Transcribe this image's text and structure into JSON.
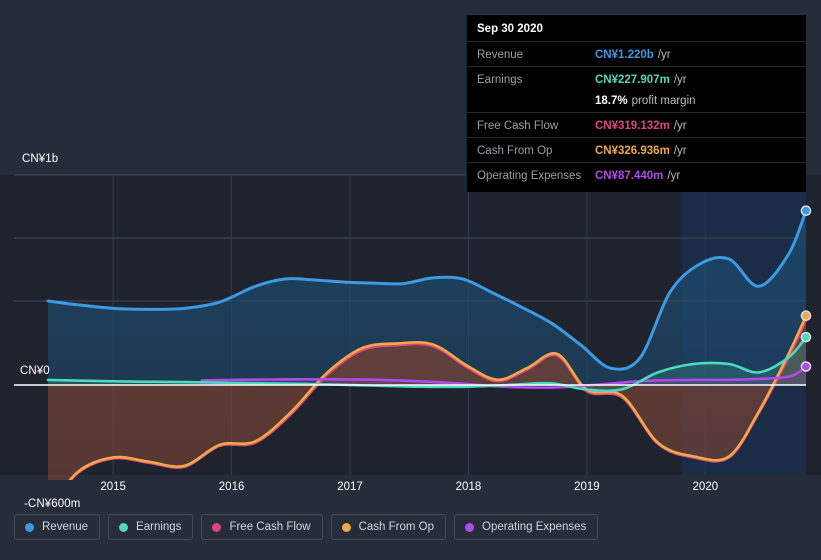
{
  "tooltip": {
    "date": "Sep 30 2020",
    "rows": [
      {
        "key": "Revenue",
        "value": "CN¥1.220b",
        "unit": "/yr",
        "color": "#3b9ae1"
      },
      {
        "key": "Earnings",
        "value": "CN¥227.907m",
        "unit": "/yr",
        "color": "#4fd8c0"
      },
      {
        "key": "",
        "value": "18.7%",
        "unit": "profit margin",
        "color": "#ffffff"
      },
      {
        "key": "Free Cash Flow",
        "value": "CN¥319.132m",
        "unit": "/yr",
        "color": "#e0467c"
      },
      {
        "key": "Cash From Op",
        "value": "CN¥326.936m",
        "unit": "/yr",
        "color": "#f0a848"
      },
      {
        "key": "Operating Expenses",
        "value": "CN¥87.440m",
        "unit": "/yr",
        "color": "#b04ae8"
      }
    ]
  },
  "legend": {
    "items": [
      {
        "label": "Revenue",
        "color": "#3b9ae1"
      },
      {
        "label": "Earnings",
        "color": "#4fd8c0"
      },
      {
        "label": "Free Cash Flow",
        "color": "#e0467c"
      },
      {
        "label": "Cash From Op",
        "color": "#f0a848"
      },
      {
        "label": "Operating Expenses",
        "color": "#b04ae8"
      }
    ]
  },
  "chart_data": {
    "type": "area",
    "title": "",
    "xlabel": "",
    "ylabel": "",
    "currency": "CN¥",
    "grid": true,
    "legend_position": "bottom",
    "y_axis": {
      "ticks": [
        {
          "label": "CN¥1b",
          "value": 1000
        },
        {
          "label": "CN¥0",
          "value": 0
        },
        {
          "label": "-CN¥600m",
          "value": -600
        }
      ],
      "ylim": [
        -600,
        1000
      ],
      "unit": "millions CN¥"
    },
    "x_axis": {
      "tick_labels": [
        "2015",
        "2016",
        "2017",
        "2018",
        "2019",
        "2020"
      ],
      "tick_values": [
        2015,
        2016,
        2017,
        2018,
        2019,
        2020
      ],
      "xlim": [
        2014.45,
        2020.85
      ]
    },
    "highlight_band": {
      "from": 2019.8,
      "to": 2020.85
    },
    "series": [
      {
        "name": "Revenue",
        "color": "#3b9ae1",
        "fill": "#1d4a6e",
        "x": [
          2014.45,
          2014.7,
          2015.0,
          2015.3,
          2015.6,
          2015.9,
          2016.2,
          2016.45,
          2016.7,
          2016.95,
          2017.2,
          2017.45,
          2017.7,
          2017.95,
          2018.2,
          2018.45,
          2018.7,
          2018.95,
          2019.2,
          2019.45,
          2019.7,
          2019.95,
          2020.2,
          2020.45,
          2020.7,
          2020.85
        ],
        "values": [
          400,
          382,
          365,
          360,
          365,
          395,
          470,
          505,
          500,
          490,
          485,
          483,
          510,
          505,
          440,
          370,
          295,
          190,
          80,
          130,
          440,
          575,
          600,
          470,
          620,
          830
        ]
      },
      {
        "name": "Earnings",
        "color": "#4fd8c0",
        "fill": "#2f7a77",
        "x": [
          2014.45,
          2014.8,
          2015.2,
          2015.6,
          2016.0,
          2016.4,
          2016.8,
          2017.2,
          2017.6,
          2018.0,
          2018.4,
          2018.7,
          2019.0,
          2019.3,
          2019.6,
          2019.9,
          2020.2,
          2020.45,
          2020.7,
          2020.85
        ],
        "values": [
          24,
          20,
          16,
          14,
          10,
          7,
          3,
          -3,
          -8,
          -8,
          2,
          8,
          -22,
          -20,
          60,
          100,
          100,
          60,
          130,
          228
        ]
      },
      {
        "name": "Free Cash Flow",
        "color": "#e0467c",
        "fill": "#6e2b3c",
        "x": [
          2014.45,
          2014.7,
          2015.0,
          2015.3,
          2015.6,
          2015.9,
          2016.2,
          2016.5,
          2016.8,
          2017.1,
          2017.4,
          2017.7,
          2018.0,
          2018.25,
          2018.5,
          2018.75,
          2019.0,
          2019.3,
          2019.6,
          2019.9,
          2020.2,
          2020.45,
          2020.7,
          2020.85
        ],
        "values": [
          -600,
          -420,
          -350,
          -370,
          -390,
          -290,
          -275,
          -140,
          45,
          165,
          190,
          185,
          80,
          18,
          75,
          140,
          -30,
          -60,
          -280,
          -345,
          -345,
          -135,
          130,
          310
        ]
      },
      {
        "name": "Cash From Op",
        "color": "#f0a848",
        "fill": "#6e4a33",
        "x": [
          2014.45,
          2014.7,
          2015.0,
          2015.3,
          2015.6,
          2015.9,
          2016.2,
          2016.5,
          2016.8,
          2017.1,
          2017.4,
          2017.7,
          2018.0,
          2018.25,
          2018.5,
          2018.75,
          2019.0,
          2019.3,
          2019.6,
          2019.9,
          2020.2,
          2020.45,
          2020.7,
          2020.85
        ],
        "values": [
          -600,
          -415,
          -345,
          -365,
          -385,
          -285,
          -268,
          -130,
          55,
          175,
          198,
          193,
          88,
          25,
          82,
          148,
          -22,
          -52,
          -275,
          -340,
          -340,
          -128,
          145,
          330
        ]
      },
      {
        "name": "Operating Expenses",
        "color": "#b04ae8",
        "fill": "#6b4c8c",
        "x": [
          2014.45,
          2015.55,
          2015.75,
          2016.1,
          2016.6,
          2017.1,
          2017.5,
          2017.9,
          2018.3,
          2018.7,
          2019.1,
          2019.5,
          2019.9,
          2020.3,
          2020.7,
          2020.85
        ],
        "values": [
          null,
          null,
          22,
          25,
          27,
          26,
          20,
          8,
          -8,
          -12,
          2,
          20,
          24,
          26,
          40,
          88
        ]
      }
    ],
    "endpoint_markers": [
      {
        "series": "Revenue",
        "value": 830,
        "color": "#3b9ae1"
      },
      {
        "series": "Cash From Op",
        "value": 330,
        "color": "#f0a848"
      },
      {
        "series": "Earnings",
        "value": 228,
        "color": "#4fd8c0"
      },
      {
        "series": "Operating Expenses",
        "value": 88,
        "color": "#b04ae8"
      }
    ]
  }
}
